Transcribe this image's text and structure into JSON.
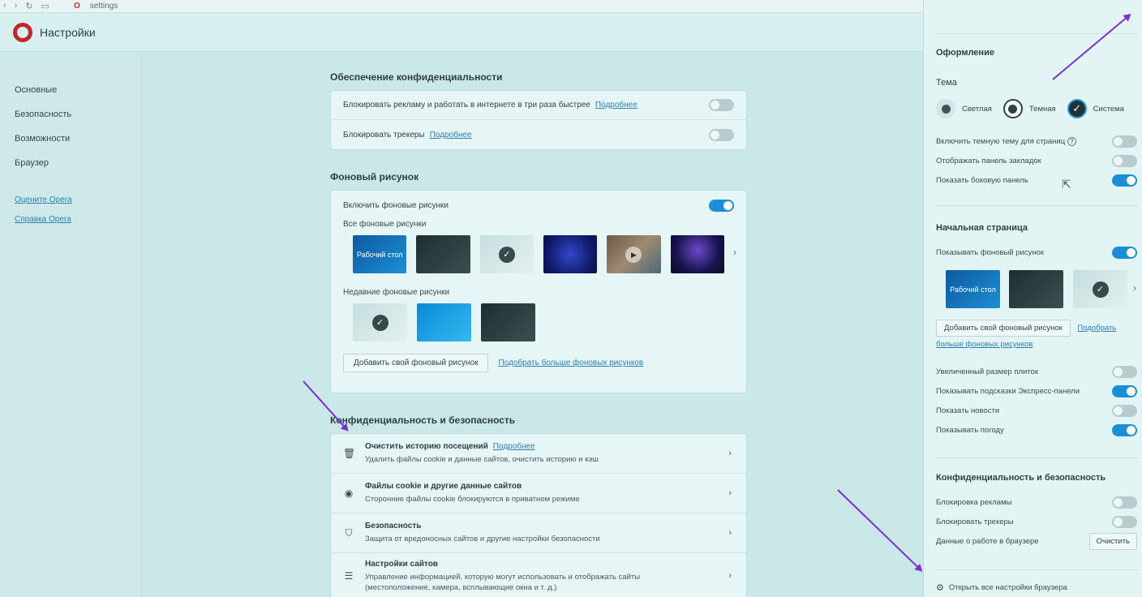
{
  "browser": {
    "tab_title": "settings",
    "nav_icons": [
      "back-icon",
      "forward-icon",
      "reload-icon",
      "tabs-icon"
    ]
  },
  "header": {
    "title": "Настройки"
  },
  "sidebar": {
    "items": [
      {
        "label": "Основные"
      },
      {
        "label": "Безопасность"
      },
      {
        "label": "Возможности"
      },
      {
        "label": "Браузер"
      }
    ],
    "links": [
      {
        "label": "Оцените Opera"
      },
      {
        "label": "Справка Opera"
      }
    ]
  },
  "privacy": {
    "title": "Обеспечение конфиденциальности",
    "rows": [
      {
        "label": "Блокировать рекламу и работать в интернете в три раза быстрее",
        "link": "Подробнее",
        "on": false
      },
      {
        "label": "Блокировать трекеры",
        "link": "Подробнее",
        "on": false
      }
    ]
  },
  "wallpaper": {
    "title": "Фоновый рисунок",
    "enable_label": "Включить фоновые рисунки",
    "enable_on": true,
    "all_label": "Все фоновые рисунки",
    "recent_label": "Недавние фоновые рисунки",
    "desktop_label": "Рабочий стол",
    "add_button": "Добавить свой фоновый рисунок",
    "more_link": "Подобрать больше фоновых рисунков"
  },
  "security": {
    "title": "Конфиденциальность и безопасность",
    "rows": [
      {
        "icon": "trash-icon",
        "title": "Очистить историю посещений",
        "link": "Подробнее",
        "desc": "Удалить файлы cookie и данные сайтов, очистить историю и кэш"
      },
      {
        "icon": "cookie-icon",
        "title": "Файлы cookie и другие данные сайтов",
        "desc": "Сторонние файлы cookie блокируются в приватном режиме"
      },
      {
        "icon": "shield-icon",
        "title": "Безопасность",
        "desc": "Защита от вредоносных сайтов и другие настройки безопасности"
      },
      {
        "icon": "sliders-icon",
        "title": "Настройки сайтов",
        "desc": "Управление информацией, которую могут использовать и отображать сайты",
        "desc2": "(местоположение, камера, всплывающие окна и т. д.)"
      }
    ]
  },
  "panel": {
    "appearance_title": "Оформление",
    "theme_label": "Тема",
    "themes": [
      {
        "label": "Светлая"
      },
      {
        "label": "Темная"
      },
      {
        "label": "Система"
      }
    ],
    "appearance_rows": [
      {
        "label": "Включить темную тему для страниц",
        "on": false
      },
      {
        "label": "Отображать панель закладок",
        "on": false
      },
      {
        "label": "Показать боковую панель",
        "on": true
      }
    ],
    "start_title": "Начальная страница",
    "start_wallpaper_label": "Показывать фоновый рисунок",
    "start_wallpaper_on": true,
    "desktop_label": "Рабочий стол",
    "add_button": "Добавить свой фоновый рисунок",
    "more_link": "Подобрать больше фоновых рисунков",
    "start_rows": [
      {
        "label": "Увеличенный размер плиток",
        "on": false
      },
      {
        "label": "Показывать подсказки Экспресс-панели",
        "on": true
      },
      {
        "label": "Показать новости",
        "on": false
      },
      {
        "label": "Показывать погоду",
        "on": true
      }
    ],
    "privacy_title": "Конфиденциальность и безопасность",
    "privacy_rows": [
      {
        "label": "Блокировка рекламы",
        "on": false
      },
      {
        "label": "Блокировать трекеры",
        "on": false
      }
    ],
    "browser_data_label": "Данные о работе в браузере",
    "clear_button": "Очистить",
    "all_settings_label": "Открыть все настройки браузера"
  },
  "colors": {
    "accent": "#1a8fd8",
    "opera_red": "#c0282d",
    "annotation_arrow": "#7b2ed6"
  }
}
